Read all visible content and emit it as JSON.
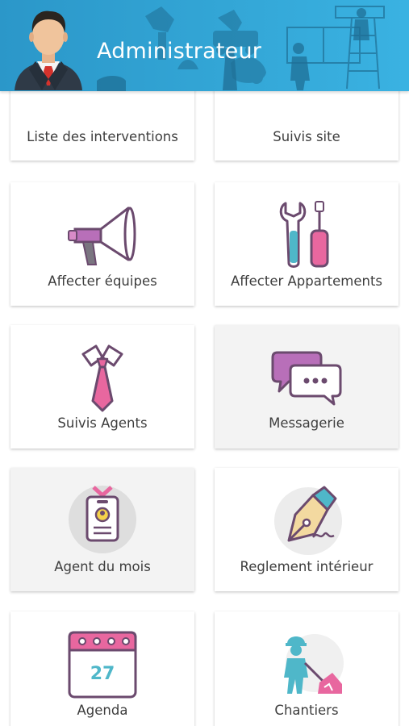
{
  "header": {
    "title": "Administrateur",
    "avatar_icon": "businessman-avatar-icon",
    "background_art": "cleaning-workers-illustration",
    "color": "#33a6d6"
  },
  "menu": [
    {
      "label": "Liste des interventions",
      "icon": "checklist-icon"
    },
    {
      "label": "Suivis site",
      "icon": "id-card-icon"
    },
    {
      "label": "Affecter équipes",
      "icon": "megaphone-icon"
    },
    {
      "label": "Affecter Appartements",
      "icon": "wrench-screwdriver-icon"
    },
    {
      "label": "Suivis Agents",
      "icon": "tie-icon"
    },
    {
      "label": "Messagerie",
      "icon": "chat-bubbles-icon"
    },
    {
      "label": "Agent du mois",
      "icon": "badge-icon"
    },
    {
      "label": "Reglement intérieur",
      "icon": "fountain-pen-icon"
    },
    {
      "label": "Agenda",
      "icon": "calendar-icon",
      "day": "27"
    },
    {
      "label": "Chantiers",
      "icon": "construction-worker-icon"
    }
  ],
  "colors": {
    "pink": "#e8679f",
    "purple": "#b86fb9",
    "teal": "#4fb7c9",
    "outline": "#6b4a6e"
  }
}
